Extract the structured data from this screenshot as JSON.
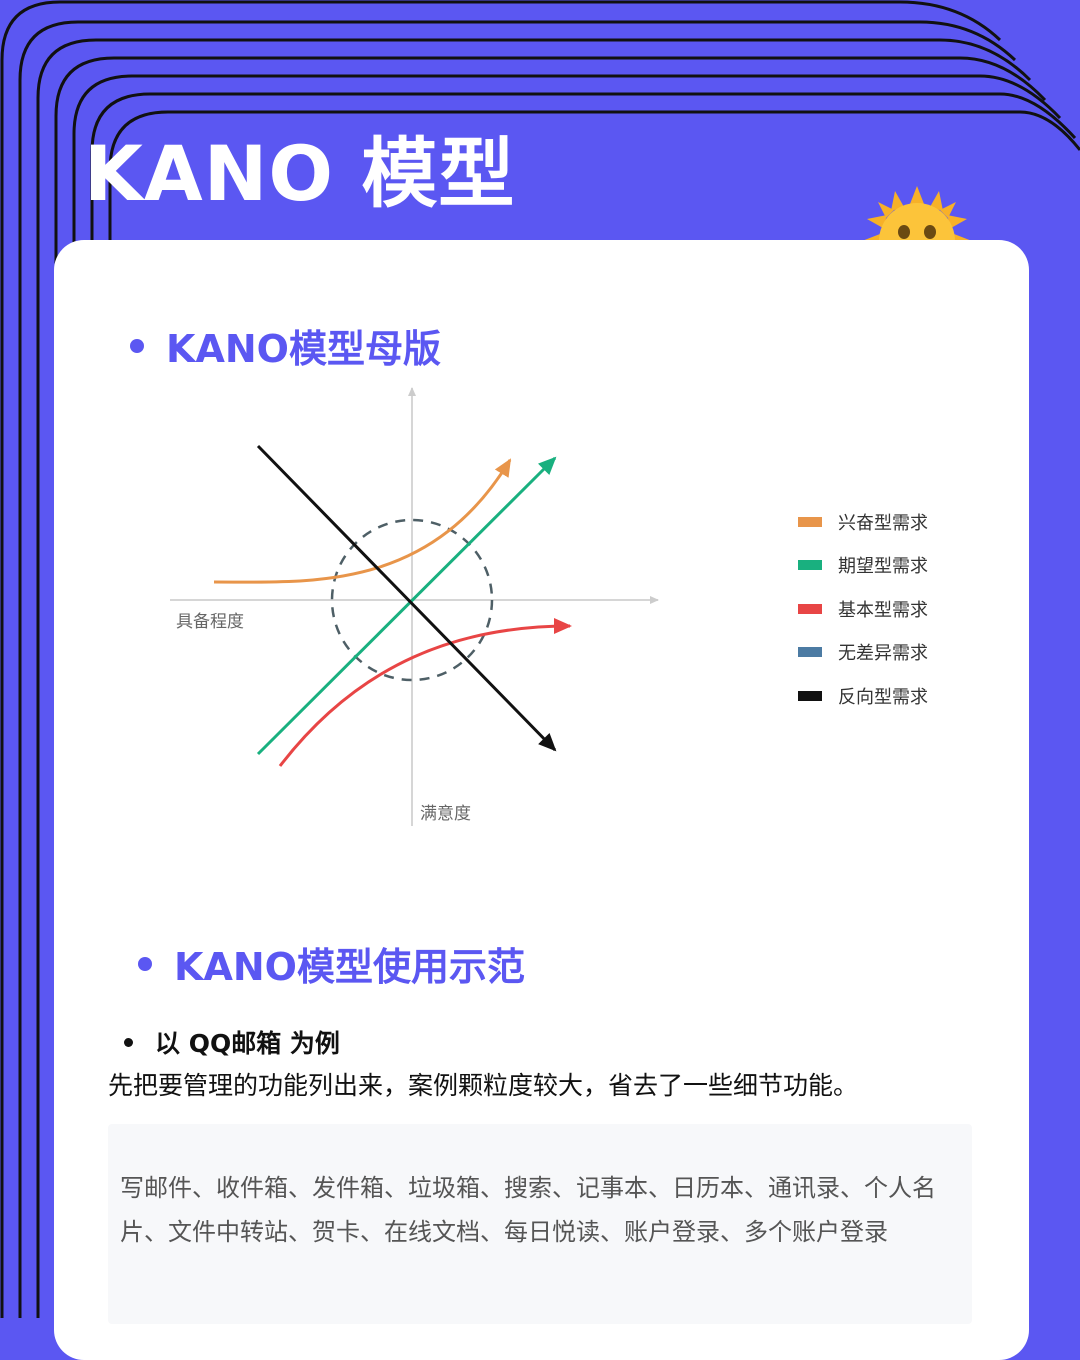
{
  "page": {
    "title": "KANO 模型"
  },
  "colors": {
    "background": "#5b57f2",
    "accent": "#5b57f2",
    "card": "#ffffff"
  },
  "icons": {
    "decoration": "sun-face-icon"
  },
  "sections": {
    "template_heading": "KANO模型母版",
    "example_heading": "KANO模型使用示范"
  },
  "diagram": {
    "x_axis_label": "具备程度",
    "y_axis_label": "满意度",
    "legend": [
      {
        "label": "兴奋型需求",
        "color": "#e8954a"
      },
      {
        "label": "期望型需求",
        "color": "#19b07f"
      },
      {
        "label": "基本型需求",
        "color": "#e84545"
      },
      {
        "label": "无差异需求",
        "color": "#4c7ba3"
      },
      {
        "label": "反向型需求",
        "color": "#111111"
      }
    ]
  },
  "example": {
    "bullet": "以 QQ邮箱 为例",
    "intro": "先把要管理的功能列出来，案例颗粒度较大，省去了一些细节功能。",
    "features": "写邮件、收件箱、发件箱、垃圾箱、搜索、记事本、日历本、通讯录、个人名片、文件中转站、贺卡、在线文档、每日悦读、账户登录、多个账户登录"
  }
}
